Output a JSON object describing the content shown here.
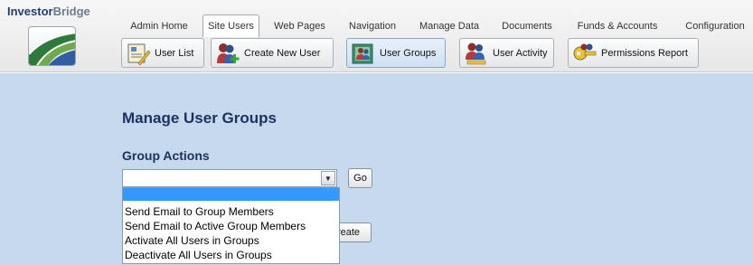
{
  "brand": {
    "part1": "Investor",
    "part2": "Bridge"
  },
  "tabs": [
    {
      "label": "Admin Home"
    },
    {
      "label": "Site Users",
      "active": true
    },
    {
      "label": "Web Pages"
    },
    {
      "label": "Navigation"
    },
    {
      "label": "Manage Data"
    },
    {
      "label": "Documents"
    },
    {
      "label": "Funds & Accounts"
    },
    {
      "label": "Configuration"
    }
  ],
  "toolbar": {
    "user_list": "User List",
    "create_new_user": "Create New User",
    "user_groups": "User Groups",
    "user_activity": "User Activity",
    "permissions_report": "Permissions Report"
  },
  "icons": {
    "user_list": "user-list-icon",
    "create_new_user": "add-user-icon",
    "user_groups": "user-groups-icon",
    "user_activity": "user-activity-icon",
    "permissions_report": "permissions-key-icon",
    "dropdown_arrow": "chevron-down-icon"
  },
  "main": {
    "title": "Manage User Groups",
    "group_actions_heading": "Group Actions",
    "select_value": "",
    "go_label": "Go",
    "create_label_visible": "reate"
  },
  "dropdown_options": [
    "",
    "Send Email to Group Members",
    "Send Email to Active Group Members",
    "Activate All Users in Groups",
    "Deactivate All Users in Groups"
  ],
  "colors": {
    "content_bg": "#c7d9ec",
    "heading": "#1b3361",
    "highlight": "#3399ff",
    "brand_dark": "#1e3f73"
  }
}
